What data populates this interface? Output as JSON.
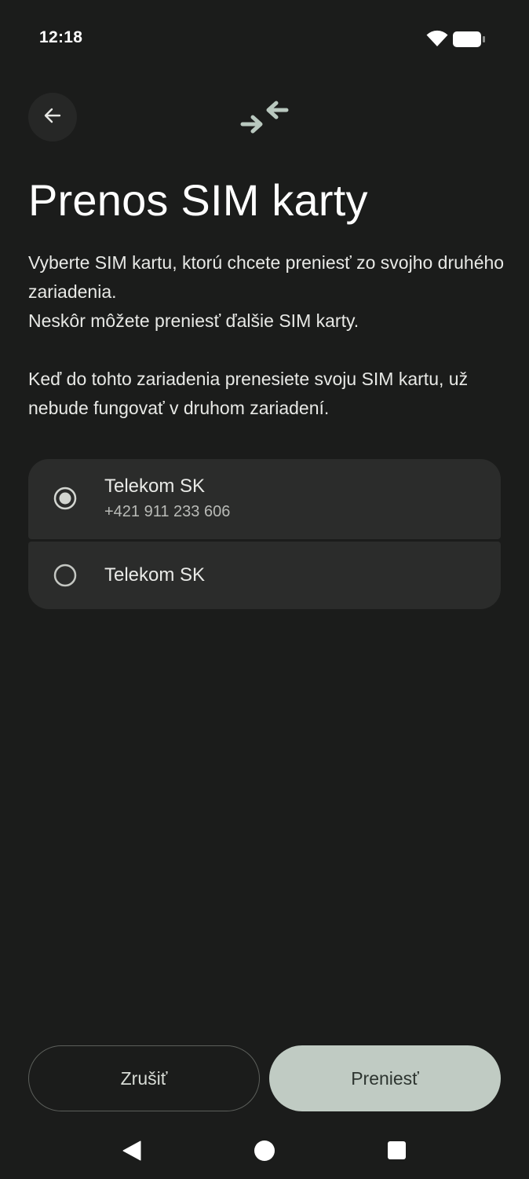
{
  "status_bar": {
    "time": "12:18"
  },
  "header": {
    "back_icon": "arrow-left-icon",
    "transfer_icon": "arrows-swap-icon"
  },
  "title": "Prenos SIM karty",
  "description": {
    "line1": "Vyberte SIM kartu, ktorú chcete preniesť zo svojho druhého zariadenia.",
    "line2": "Neskôr môžete preniesť ďalšie SIM karty.",
    "paragraph2": "Keď do tohto zariadenia prenesiete svoju SIM kartu, už nebude fungovať v druhom zariadení."
  },
  "sim_options": [
    {
      "name": "Telekom SK",
      "number": "+421 911 233 606",
      "selected": true
    },
    {
      "name": "Telekom SK",
      "number": "",
      "selected": false
    }
  ],
  "buttons": {
    "cancel": "Zrušiť",
    "transfer": "Preniesť"
  },
  "colors": {
    "background": "#1b1c1b",
    "card": "#2b2c2b",
    "primary_button": "#c0cbc3",
    "accent_icon": "#b9c8bf"
  }
}
